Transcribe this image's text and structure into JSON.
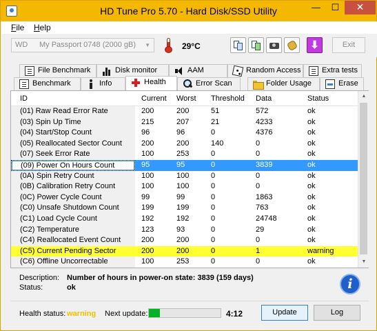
{
  "window": {
    "title": "HD Tune Pro 5.70 - Hard Disk/SSD Utility",
    "minimize": "—",
    "maximize": "☐",
    "close": "✕"
  },
  "menu": {
    "file": "File",
    "help": "Help"
  },
  "toolbar": {
    "drive_brand": "WD",
    "drive_name": "My Passport 0748 (2000 gB)",
    "temperature": "29°C",
    "exit_label": "Exit"
  },
  "tabs_top": [
    "File Benchmark",
    "Disk monitor",
    "AAM",
    "Random Access",
    "Extra tests"
  ],
  "tabs_bottom": [
    "Benchmark",
    "Info",
    "Health",
    "Error Scan",
    "Folder Usage",
    "Erase"
  ],
  "active_tab": "Health",
  "table": {
    "columns": [
      "ID",
      "Current",
      "Worst",
      "Threshold",
      "Data",
      "Status"
    ],
    "rows": [
      {
        "id": "(01) Raw Read Error Rate",
        "current": "200",
        "worst": "200",
        "threshold": "51",
        "data": "572",
        "status": "ok"
      },
      {
        "id": "(03) Spin Up Time",
        "current": "215",
        "worst": "207",
        "threshold": "21",
        "data": "4233",
        "status": "ok"
      },
      {
        "id": "(04) Start/Stop Count",
        "current": "96",
        "worst": "96",
        "threshold": "0",
        "data": "4376",
        "status": "ok"
      },
      {
        "id": "(05) Reallocated Sector Count",
        "current": "200",
        "worst": "200",
        "threshold": "140",
        "data": "0",
        "status": "ok"
      },
      {
        "id": "(07) Seek Error Rate",
        "current": "100",
        "worst": "253",
        "threshold": "0",
        "data": "0",
        "status": "ok"
      },
      {
        "id": "(09) Power On Hours Count",
        "current": "95",
        "worst": "95",
        "threshold": "0",
        "data": "3839",
        "status": "ok",
        "state": "selected"
      },
      {
        "id": "(0A) Spin Retry Count",
        "current": "100",
        "worst": "100",
        "threshold": "0",
        "data": "0",
        "status": "ok"
      },
      {
        "id": "(0B) Calibration Retry Count",
        "current": "100",
        "worst": "100",
        "threshold": "0",
        "data": "0",
        "status": "ok"
      },
      {
        "id": "(0C) Power Cycle Count",
        "current": "99",
        "worst": "99",
        "threshold": "0",
        "data": "1863",
        "status": "ok"
      },
      {
        "id": "(C0) Unsafe Shutdown Count",
        "current": "199",
        "worst": "199",
        "threshold": "0",
        "data": "763",
        "status": "ok"
      },
      {
        "id": "(C1) Load Cycle Count",
        "current": "192",
        "worst": "192",
        "threshold": "0",
        "data": "24748",
        "status": "ok"
      },
      {
        "id": "(C2) Temperature",
        "current": "123",
        "worst": "93",
        "threshold": "0",
        "data": "29",
        "status": "ok"
      },
      {
        "id": "(C4) Reallocated Event Count",
        "current": "200",
        "worst": "200",
        "threshold": "0",
        "data": "0",
        "status": "ok"
      },
      {
        "id": "(C5) Current Pending Sector",
        "current": "200",
        "worst": "200",
        "threshold": "0",
        "data": "1",
        "status": "warning",
        "state": "warning"
      },
      {
        "id": "(C6) Offline Uncorrectable",
        "current": "100",
        "worst": "253",
        "threshold": "0",
        "data": "0",
        "status": "ok"
      }
    ]
  },
  "description": {
    "label": "Description:",
    "value": "Number of hours in power-on state: 3839 (159 days)",
    "status_label": "Status:",
    "status_value": "ok"
  },
  "footer": {
    "health_label": "Health status:",
    "health_value": "warning",
    "health_color": "#f0c000",
    "next_update_label": "Next update:",
    "progress_fraction": 0.15,
    "timer": "4:12",
    "update_button": "Update",
    "log_button": "Log"
  },
  "colors": {
    "titlebar": "#f5b800",
    "selection": "#3399ff",
    "warning_row": "#ffff33",
    "progress": "#06b025"
  },
  "icons": [
    "thermometer-icon",
    "copy-icon",
    "copy-green-icon",
    "camera-icon",
    "hand-icon",
    "download-arrow-icon",
    "info-icon"
  ]
}
